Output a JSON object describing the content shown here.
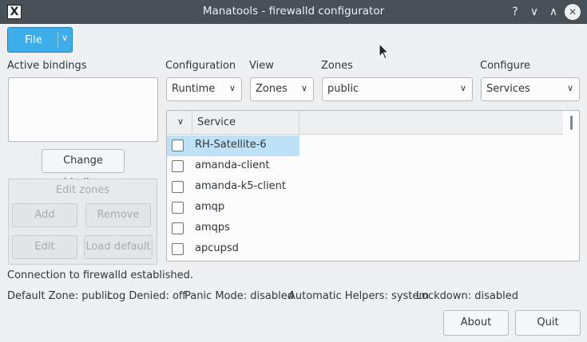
{
  "window": {
    "title": "Manatools - firewalld configurator",
    "help_glyph": "?",
    "minimize_glyph": "∨",
    "maximize_glyph": "∧",
    "close_glyph": "✕",
    "app_icon_glyph": "X"
  },
  "toolbar": {
    "file_label": "File",
    "file_arrow": "∨"
  },
  "active_bindings": {
    "label": "Active bindings",
    "change_binding_label": "Change binding"
  },
  "selectors": {
    "configuration": {
      "label": "Configuration",
      "value": "Runtime"
    },
    "view": {
      "label": "View",
      "value": "Zones"
    },
    "zones": {
      "label": "Zones",
      "value": "public"
    },
    "configure": {
      "label": "Configure",
      "value": "Services"
    },
    "chevron": "∨"
  },
  "edit_zones": {
    "title": "Edit zones",
    "add": "Add",
    "remove": "Remove",
    "edit": "Edit",
    "load_default": "Load default"
  },
  "services_table": {
    "header_check_glyph": "∨",
    "header_service": "Service",
    "rows": [
      {
        "name": "RH-Satellite-6",
        "checked": false,
        "selected": true
      },
      {
        "name": "amanda-client",
        "checked": false,
        "selected": false
      },
      {
        "name": "amanda-k5-client",
        "checked": false,
        "selected": false
      },
      {
        "name": "amqp",
        "checked": false,
        "selected": false
      },
      {
        "name": "amqps",
        "checked": false,
        "selected": false
      },
      {
        "name": "apcupsd",
        "checked": false,
        "selected": false
      }
    ]
  },
  "status": {
    "connection": "Connection to firewalld established.",
    "default_zone": "Default Zone: public",
    "log_denied": "Log Denied: off",
    "panic_mode": "Panic Mode: disabled",
    "automatic_helpers": "Automatic Helpers: system",
    "lockdown": "Lockdown: disabled"
  },
  "footer": {
    "about": "About",
    "quit": "Quit"
  },
  "colors": {
    "titlebar": "#475057",
    "accent": "#3daee9",
    "selection": "#bfe1f5",
    "background": "#eff0f1"
  }
}
